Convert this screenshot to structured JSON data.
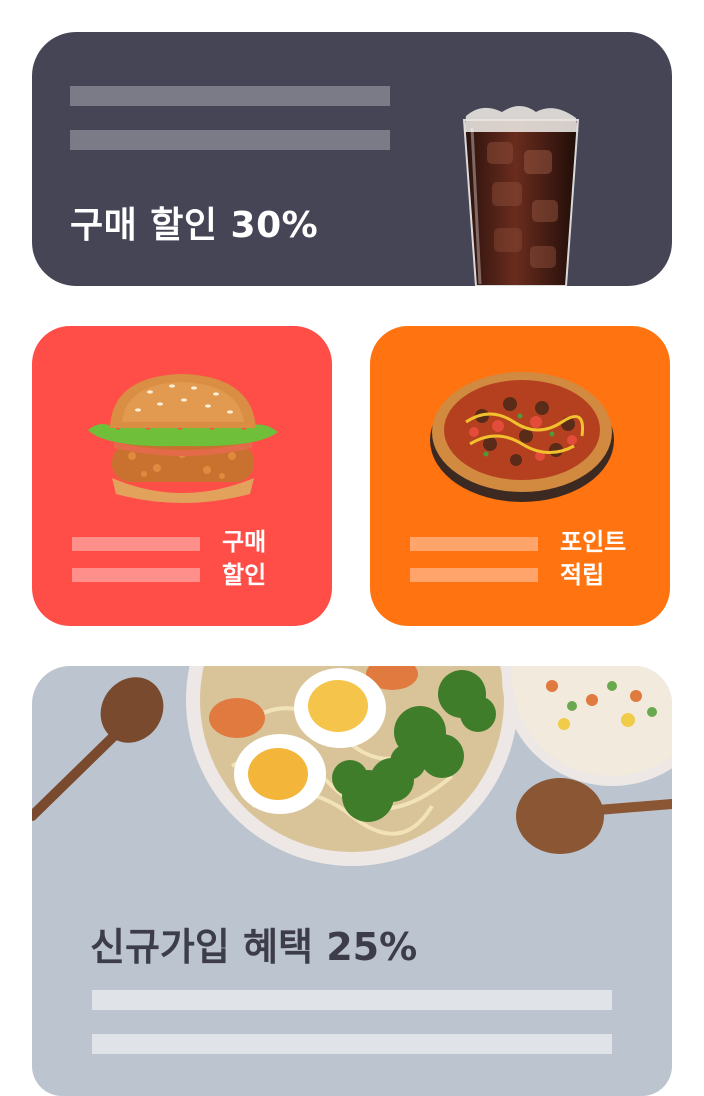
{
  "promo_top": {
    "title": "구매 할인 30%",
    "image": "cola-glass-icon",
    "color": "#464556"
  },
  "promo_burger": {
    "label_line1": "구매",
    "label_line2": "할인",
    "image": "burger-icon",
    "color": "#ff4d47"
  },
  "promo_pizza": {
    "label_line1": "포인트",
    "label_line2": "적립",
    "image": "pizza-icon",
    "color": "#ff7310"
  },
  "promo_bottom": {
    "title": "신규가입 혜택 25%",
    "image": "noodle-bowls-photo"
  }
}
